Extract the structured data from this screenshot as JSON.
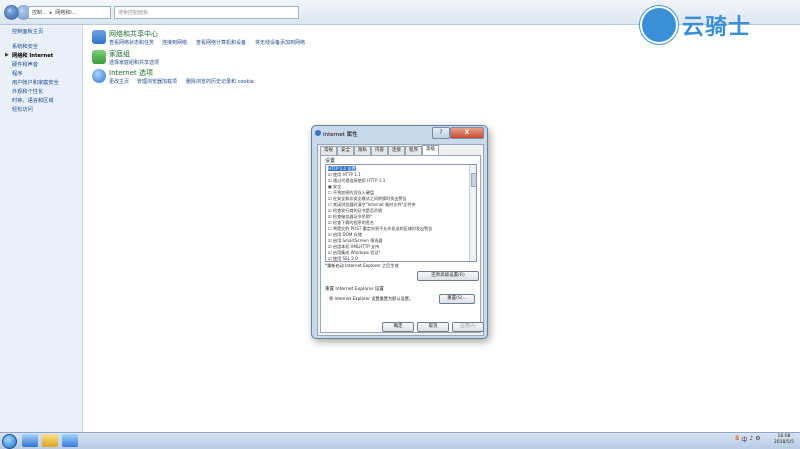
{
  "address": {
    "crumb_segments": [
      "控制...",
      "网络和I..."
    ],
    "search_placeholder": "搜索控制面板"
  },
  "logo": {
    "text": "云骑士"
  },
  "left_pane": {
    "items": [
      {
        "label": "控制面板主页",
        "selected": false
      },
      {
        "label": "系统和安全",
        "selected": false
      },
      {
        "label": "网络和 Internet",
        "selected": true
      },
      {
        "label": "硬件和声音",
        "selected": false
      },
      {
        "label": "程序",
        "selected": false
      },
      {
        "label": "用户帐户和家庭安全",
        "selected": false
      },
      {
        "label": "外观和个性化",
        "selected": false
      },
      {
        "label": "时钟、语言和区域",
        "selected": false
      },
      {
        "label": "轻松访问",
        "selected": false
      }
    ]
  },
  "categories": [
    {
      "title": "网络和共享中心",
      "links": [
        "查看网络状态和任务",
        "连接到网络",
        "查看网络计算机和设备",
        "将无线设备添加到网络"
      ],
      "icon_color": "#2f74c8"
    },
    {
      "title": "家庭组",
      "links": [
        "选择家庭组和共享选项"
      ],
      "icon_color": "#3a9c3a"
    },
    {
      "title": "Internet 选项",
      "links": [
        "更改主页",
        "管理浏览器加载项",
        "删除浏览的历史记录和 cookie"
      ],
      "icon_color": "#2f74c8"
    }
  ],
  "dialog": {
    "title": "Internet 属性",
    "help_label": "?",
    "close_label": "X",
    "tabs": [
      "常规",
      "安全",
      "隐私",
      "内容",
      "连接",
      "程序",
      "高级"
    ],
    "active_tab": 6,
    "settings_label": "设置",
    "settings": [
      {
        "text": "HTTP 1.1 设置",
        "selected": true
      },
      {
        "text": "☑ 使用 HTTP 1.1",
        "selected": false
      },
      {
        "text": "☑ 通过代理连接使用 HTTP 1.1",
        "selected": false
      },
      {
        "text": "▣ 安全",
        "selected": false
      },
      {
        "text": "☐ 不将加密的页存入硬盘",
        "selected": false
      },
      {
        "text": "☑ 在安全和非安全模式之间转换时发出警告",
        "selected": false
      },
      {
        "text": "☐ 关闭浏览器时清空\"Internet 临时文件\"文件夹",
        "selected": false
      },
      {
        "text": "☑ 检查发行商的证书是否吊销",
        "selected": false
      },
      {
        "text": "☑ 检查服务器证书吊销*",
        "selected": false
      },
      {
        "text": "☑ 检查下载的程序的签名",
        "selected": false
      },
      {
        "text": "☐ 将提交的 POST 重定向到不允许发送的区域时发出警告",
        "selected": false
      },
      {
        "text": "☑ 启用 DOM 存储",
        "selected": false
      },
      {
        "text": "☑ 启用 SmartScreen 筛选器",
        "selected": false
      },
      {
        "text": "☑ 启用本机 XMLHTTP 支持",
        "selected": false
      },
      {
        "text": "☑ 启用集成 Windows 验证*",
        "selected": false
      },
      {
        "text": "☑ 使用 SSL 2.0",
        "selected": false
      }
    ],
    "restart_note": "*重新启动 Internet Explorer 之后生效",
    "restore_button": "还原高级设置(R)",
    "reset_group_title": "重置 Internet Explorer 设置",
    "reset_text": "将 Internet Explorer 设置重置为默认设置。",
    "reset_button": "重置(S)...",
    "ok_button": "确定",
    "cancel_button": "取消",
    "apply_button": "应用(A)"
  },
  "taskbar": {
    "tray_items": [
      "S",
      "中",
      "♪",
      "⚙"
    ],
    "time": "16:08",
    "date": "2018/5/5"
  }
}
